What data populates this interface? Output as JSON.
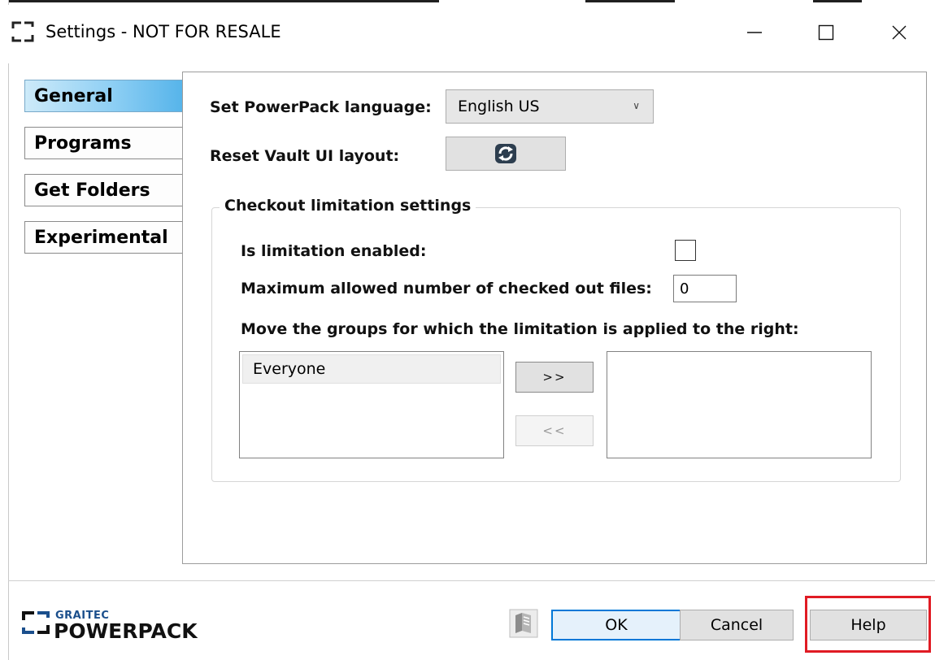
{
  "window": {
    "title": "Settings - NOT FOR RESALE"
  },
  "sidebar": {
    "items": [
      {
        "label": "General",
        "active": true
      },
      {
        "label": "Programs",
        "active": false
      },
      {
        "label": "Get Folders",
        "active": false
      },
      {
        "label": "Experimental",
        "active": false
      }
    ]
  },
  "general": {
    "language_label": "Set PowerPack language:",
    "language_value": "English US",
    "reset_label": "Reset Vault UI layout:",
    "checkout_group": {
      "title": "Checkout limitation settings",
      "enabled_label": "Is limitation enabled:",
      "enabled_checked": false,
      "max_label": "Maximum allowed number of checked out files:",
      "max_value": "0",
      "move_label": "Move the groups for which the limitation is applied to the right:",
      "available_groups": [
        "Everyone"
      ],
      "applied_groups": [],
      "move_right_label": ">>",
      "move_left_label": "<<"
    }
  },
  "footer": {
    "logo_small": "GRAITEC",
    "logo_big": "POWERPACK",
    "ok_label": "OK",
    "cancel_label": "Cancel",
    "help_label": "Help"
  },
  "colors": {
    "accent": "#0078d7",
    "nav_active": "#8ecff4",
    "highlight": "#e01b24"
  }
}
